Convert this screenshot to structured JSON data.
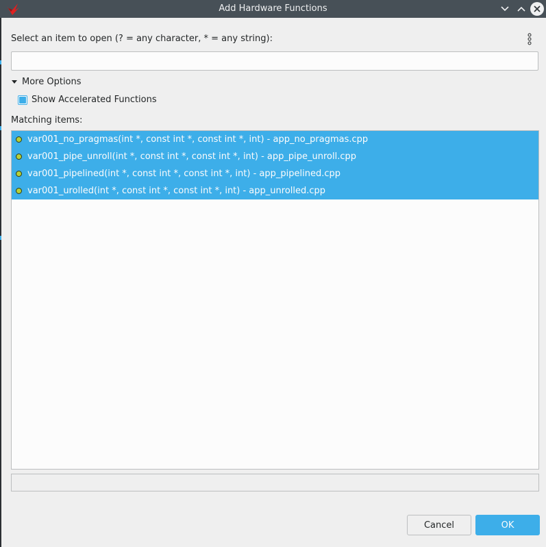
{
  "window": {
    "title": "Add Hardware Functions"
  },
  "prompt": {
    "label": "Select an item to open (? = any character, * = any string):"
  },
  "search": {
    "value": "",
    "placeholder": ""
  },
  "more_options": {
    "label": "More Options",
    "show_accelerated": {
      "label": "Show Accelerated Functions",
      "checked": true
    }
  },
  "matching": {
    "label": "Matching items:",
    "items": [
      {
        "label": "var001_no_pragmas(int *, const int *, const int *, int) - app_no_pragmas.cpp",
        "icon": "function-dot-icon",
        "selected": true
      },
      {
        "label": "var001_pipe_unroll(int *, const int *, const int *, int) - app_pipe_unroll.cpp",
        "icon": "function-dot-icon",
        "selected": true
      },
      {
        "label": "var001_pipelined(int *, const int *, const int *, int) - app_pipelined.cpp",
        "icon": "function-dot-icon",
        "selected": true
      },
      {
        "label": "var001_urolled(int *, const int *, const int *, int) - app_unrolled.cpp",
        "icon": "function-dot-icon",
        "selected": true
      }
    ]
  },
  "status": {
    "text": ""
  },
  "buttons": {
    "cancel": "Cancel",
    "ok": "OK"
  },
  "colors": {
    "accent": "#3daee9",
    "titlebar": "#475057",
    "background": "#efefef"
  }
}
